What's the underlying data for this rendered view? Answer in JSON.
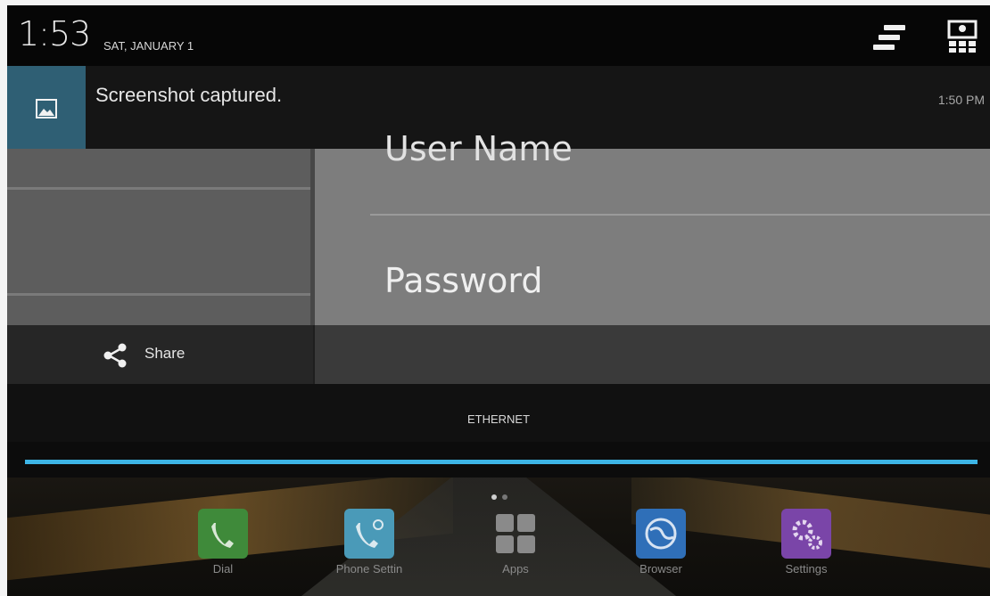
{
  "status_bar": {
    "time": "1:53",
    "date": "SAT, JANUARY 1"
  },
  "notification": {
    "text": "Screenshot captured.",
    "time": "1:50 PM"
  },
  "preview": {
    "username_label": "User Name",
    "password_label": "Password"
  },
  "share": {
    "label": "Share"
  },
  "network": {
    "label": "ETHERNET",
    "progress": 1.0
  },
  "home": {
    "page_count": 2,
    "active_page": 1,
    "dock": [
      {
        "label": "Dial",
        "icon": "phone-icon",
        "color": "#3f8a3a"
      },
      {
        "label": "Phone Settin",
        "icon": "phone-settings-icon",
        "color": "#4a9ab8"
      },
      {
        "label": "Apps",
        "icon": "apps-grid-icon",
        "color": "#7a7a7a"
      },
      {
        "label": "Browser",
        "icon": "globe-icon",
        "color": "#2f6fb8"
      },
      {
        "label": "Settings",
        "icon": "gear-icon",
        "color": "#7a45a8"
      }
    ]
  },
  "colors": {
    "accent": "#3db5e6",
    "notification_icon_bg": "#2f5f74"
  }
}
